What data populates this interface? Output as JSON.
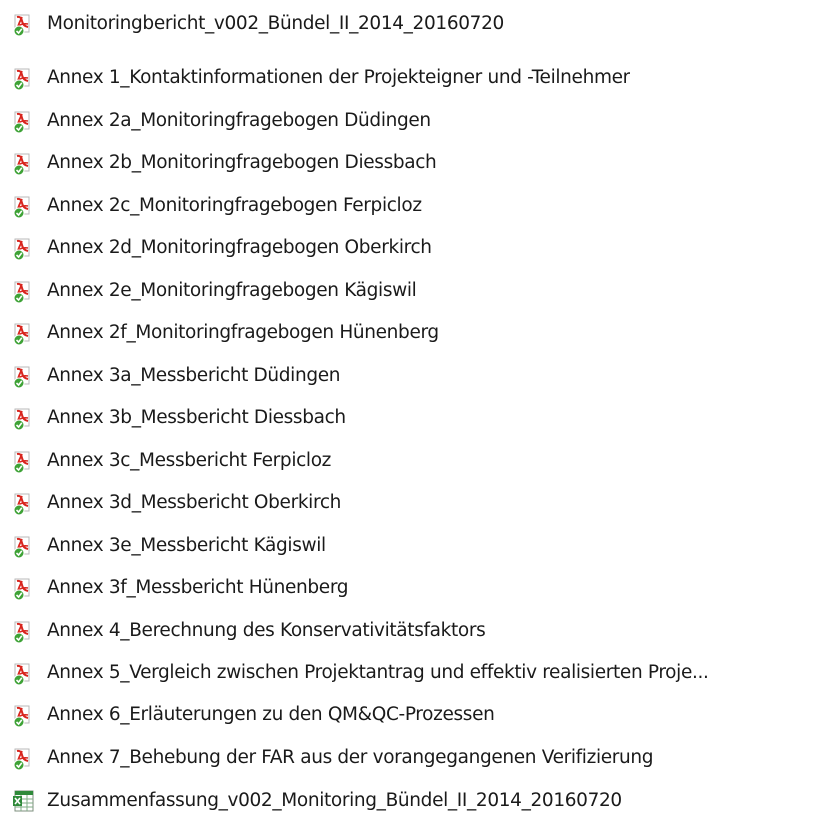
{
  "files": [
    {
      "name": "Monitoringbericht_v002_Bündel_II_2014_20160720",
      "icon": "pdf-icon"
    },
    {
      "name": "Annex 1_Kontaktinformationen der Projekteigner und -Teilnehmer",
      "icon": "pdf-icon"
    },
    {
      "name": "Annex 2a_Monitoringfragebogen Düdingen",
      "icon": "pdf-icon"
    },
    {
      "name": "Annex 2b_Monitoringfragebogen Diessbach",
      "icon": "pdf-icon"
    },
    {
      "name": "Annex 2c_Monitoringfragebogen Ferpicloz",
      "icon": "pdf-icon"
    },
    {
      "name": "Annex 2d_Monitoringfragebogen Oberkirch",
      "icon": "pdf-icon"
    },
    {
      "name": "Annex 2e_Monitoringfragebogen Kägiswil",
      "icon": "pdf-icon"
    },
    {
      "name": "Annex 2f_Monitoringfragebogen Hünenberg",
      "icon": "pdf-icon"
    },
    {
      "name": "Annex 3a_Messbericht Düdingen",
      "icon": "pdf-icon"
    },
    {
      "name": "Annex 3b_Messbericht Diessbach",
      "icon": "pdf-icon"
    },
    {
      "name": "Annex 3c_Messbericht Ferpicloz",
      "icon": "pdf-icon"
    },
    {
      "name": "Annex 3d_Messbericht Oberkirch",
      "icon": "pdf-icon"
    },
    {
      "name": "Annex 3e_Messbericht Kägiswil",
      "icon": "pdf-icon"
    },
    {
      "name": "Annex 3f_Messbericht Hünenberg",
      "icon": "pdf-icon"
    },
    {
      "name": "Annex 4_Berechnung des Konservativitätsfaktors",
      "icon": "pdf-icon"
    },
    {
      "name": "Annex 5_Vergleich zwischen Projektantrag und effektiv realisierten Proje...",
      "icon": "pdf-icon"
    },
    {
      "name": "Annex 6_Erläuterungen zu den QM&QC-Prozessen",
      "icon": "pdf-icon"
    },
    {
      "name": "Annex 7_Behebung der FAR aus der vorangegangenen Verifizierung",
      "icon": "pdf-icon"
    },
    {
      "name": "Zusammenfassung_v002_Monitoring_Bündel_II_2014_20160720",
      "icon": "spreadsheet-icon"
    }
  ],
  "colors": {
    "pdf_red": "#d8261f",
    "check_green": "#3ea236",
    "spreadsheet_green": "#2f8a3a",
    "text": "#1a1a1a"
  }
}
